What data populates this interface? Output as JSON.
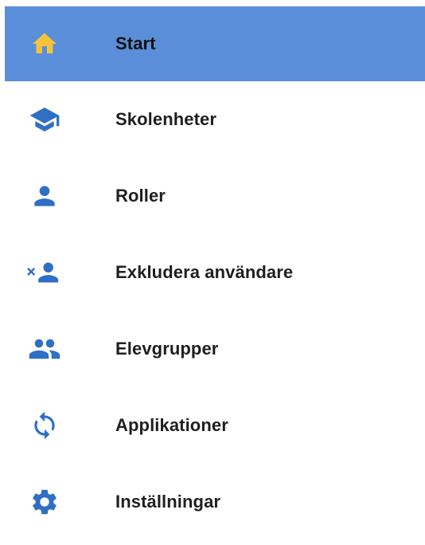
{
  "colors": {
    "active_background": "#5b8ed8",
    "icon_blue": "#2f6fc4",
    "active_icon": "#f5c33b",
    "text": "#1f1f1f"
  },
  "nav": {
    "items": [
      {
        "label": "Start",
        "icon": "home-icon",
        "active": true
      },
      {
        "label": "Skolenheter",
        "icon": "graduation-cap-icon",
        "active": false
      },
      {
        "label": "Roller",
        "icon": "person-icon",
        "active": false
      },
      {
        "label": "Exkludera användare",
        "icon": "exclude-user-icon",
        "active": false
      },
      {
        "label": "Elevgrupper",
        "icon": "group-icon",
        "active": false
      },
      {
        "label": "Applikationer",
        "icon": "sync-icon",
        "active": false
      },
      {
        "label": "Inställningar",
        "icon": "gear-icon",
        "active": false
      }
    ]
  }
}
